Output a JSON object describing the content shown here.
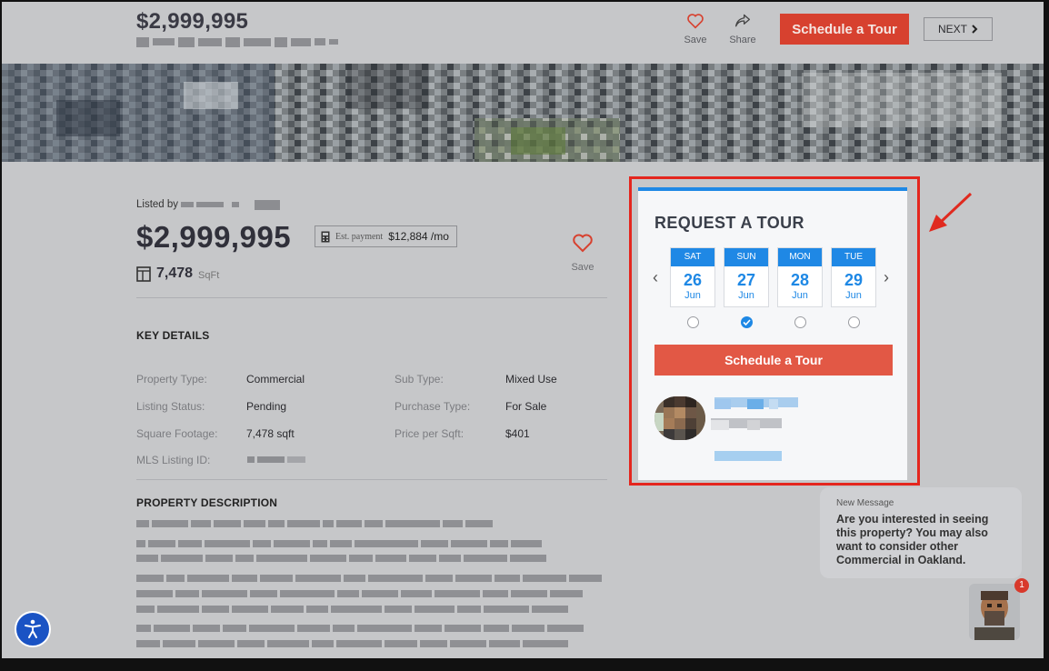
{
  "header": {
    "price": "$2,999,995",
    "save_label": "Save",
    "share_label": "Share",
    "schedule_label": "Schedule a Tour",
    "next_label": "NEXT"
  },
  "listing": {
    "listed_by_label": "Listed by",
    "price": "$2,999,995",
    "est_payment_label": "Est. payment",
    "est_payment_value": "$12,884 /mo",
    "sqft_value": "7,478",
    "sqft_unit": "SqFt",
    "save_label": "Save"
  },
  "key_details": {
    "title": "KEY DETAILS",
    "rows": [
      {
        "label": "Property Type:",
        "value": "Commercial"
      },
      {
        "label": "Sub Type:",
        "value": "Mixed Use"
      },
      {
        "label": "Listing Status:",
        "value": "Pending"
      },
      {
        "label": "Purchase Type:",
        "value": "For Sale"
      },
      {
        "label": "Square Footage:",
        "value": "7,478 sqft"
      },
      {
        "label": "Price per Sqft:",
        "value": "$401"
      },
      {
        "label": "MLS Listing ID:",
        "value": ""
      }
    ]
  },
  "description": {
    "title": "PROPERTY DESCRIPTION"
  },
  "tour": {
    "title": "REQUEST A TOUR",
    "days": [
      {
        "dow": "SAT",
        "num": "26",
        "mon": "Jun",
        "selected": false
      },
      {
        "dow": "SUN",
        "num": "27",
        "mon": "Jun",
        "selected": true
      },
      {
        "dow": "MON",
        "num": "28",
        "mon": "Jun",
        "selected": false
      },
      {
        "dow": "TUE",
        "num": "29",
        "mon": "Jun",
        "selected": false
      }
    ],
    "button_label": "Schedule a Tour"
  },
  "chat": {
    "label": "New Message",
    "message": "Are you interested in seeing this property? You may also want to consider other Commercial in Oakland.",
    "badge_count": "1"
  },
  "colors": {
    "accent_red": "#d7412f",
    "accent_blue": "#1e88e5",
    "highlight_red": "#e4261e"
  }
}
